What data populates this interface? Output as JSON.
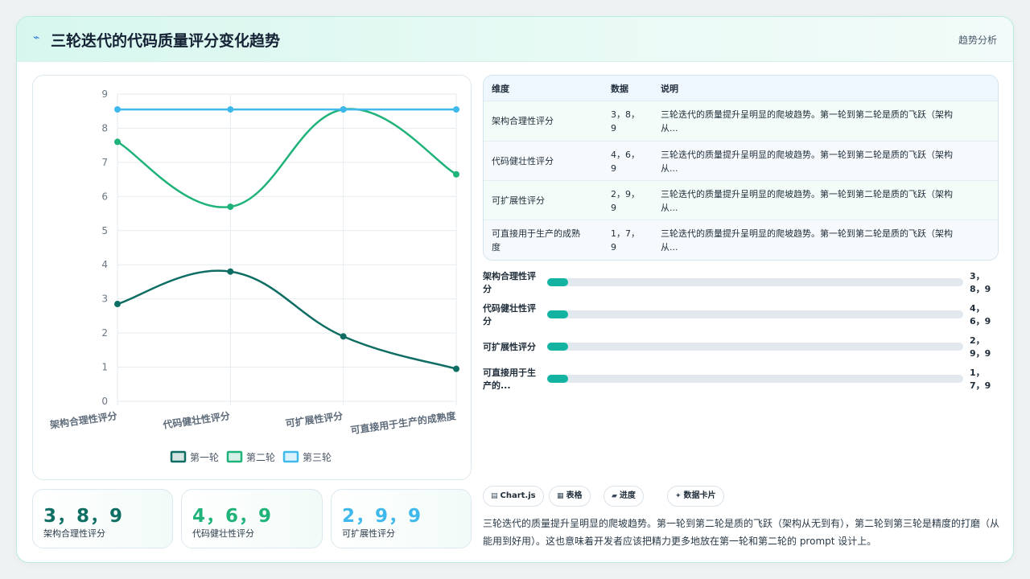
{
  "header": {
    "icon": "lightning-icon",
    "title": "三轮迭代的代码质量评分变化趋势",
    "tag": "趋势分析"
  },
  "chart_data": {
    "type": "line",
    "categories": [
      "架构合理性评分",
      "代码健壮性评分",
      "可扩展性评分",
      "可直接用于生产的成熟度"
    ],
    "series": [
      {
        "name": "第一轮",
        "values": [
          2.85,
          3.8,
          1.9,
          0.95
        ],
        "color": "#0f6e63"
      },
      {
        "name": "第二轮",
        "values": [
          7.6,
          5.7,
          8.55,
          6.65
        ],
        "color": "#1fb37a"
      },
      {
        "name": "第三轮",
        "values": [
          8.55,
          8.55,
          8.55,
          8.55
        ],
        "color": "#3fb9ec"
      }
    ],
    "ylim": [
      0,
      9
    ],
    "yticks": [
      "0",
      "1",
      "2",
      "3",
      "4",
      "5",
      "6",
      "7",
      "8",
      "9"
    ],
    "grid": true,
    "legend": "bottom"
  },
  "stats": [
    {
      "value": "3，8，9",
      "label": "架构合理性评分",
      "color": "#0f6e63"
    },
    {
      "value": "4，6，9",
      "label": "代码健壮性评分",
      "color": "#1fb37a"
    },
    {
      "value": "2，9，9",
      "label": "可扩展性评分",
      "color": "#3fb9ec"
    }
  ],
  "table": {
    "headers": [
      "维度",
      "数据",
      "说明"
    ],
    "rows": [
      {
        "dim": "架构合理性评分",
        "data_l1": "3，8，",
        "data_l2": "9",
        "desc_l1": "三轮迭代的质量提升呈明显的爬坡趋势。第一轮到第二轮是质的飞跃（架构",
        "desc_l2": "从..."
      },
      {
        "dim": "代码健壮性评分",
        "data_l1": "4，6，",
        "data_l2": "9",
        "desc_l1": "三轮迭代的质量提升呈明显的爬坡趋势。第一轮到第二轮是质的飞跃（架构",
        "desc_l2": "从..."
      },
      {
        "dim": "可扩展性评分",
        "data_l1": "2，9，",
        "data_l2": "9",
        "desc_l1": "三轮迭代的质量提升呈明显的爬坡趋势。第一轮到第二轮是质的飞跃（架构",
        "desc_l2": "从..."
      },
      {
        "dim_l1": "可直接用于生产的成熟",
        "dim_l2": "度",
        "data_l1": "1，7，",
        "data_l2": "9",
        "desc_l1": "三轮迭代的质量提升呈明显的爬坡趋势。第一轮到第二轮是质的飞跃（架构",
        "desc_l2": "从..."
      }
    ]
  },
  "progress": [
    {
      "label_l1": "架构合理性评",
      "label_l2": "分",
      "value_l1": "3，",
      "value_l2": "8，9",
      "fraction": 0.05
    },
    {
      "label_l1": "代码健壮性评",
      "label_l2": "分",
      "value_l1": "4，",
      "value_l2": "6，9",
      "fraction": 0.05
    },
    {
      "label_l1": "可扩展性评分",
      "label_l2": "",
      "value_l1": "2，",
      "value_l2": "9，9",
      "fraction": 0.05
    },
    {
      "label_l1": "可直接用于生",
      "label_l2": "产的...",
      "value_l1": "1，",
      "value_l2": "7，9",
      "fraction": 0.05
    }
  ],
  "chips": [
    {
      "icon": "chart-icon",
      "glyph": "▤",
      "label": "Chart.js"
    },
    {
      "icon": "table-icon",
      "glyph": "▦",
      "label": "表格"
    },
    {
      "icon": "progress-icon",
      "glyph": "▰",
      "label": "进度"
    },
    {
      "icon": "sparkle-icon",
      "glyph": "✦",
      "label": "数据卡片"
    }
  ],
  "summary": "三轮迭代的质量提升呈明显的爬坡趋势。第一轮到第二轮是质的飞跃（架构从无到有），第二轮到第三轮是精度的打磨（从能用到好用）。这也意味着开发者应该把精力更多地放在第一轮和第二轮的 prompt 设计上。"
}
